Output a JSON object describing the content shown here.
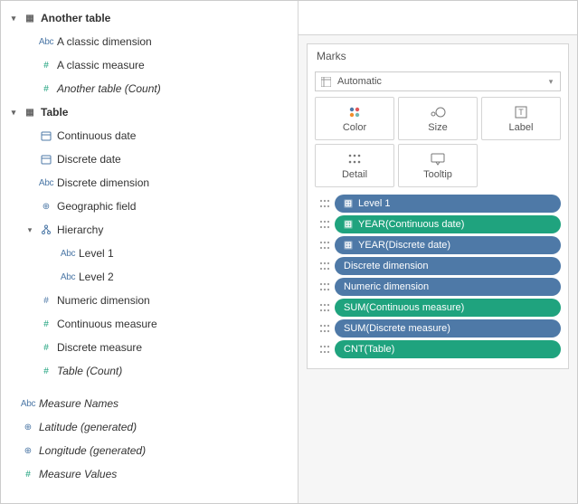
{
  "tables": [
    {
      "name": "Another table",
      "fields": [
        {
          "label": "A classic dimension",
          "icon": "abc",
          "italic": false
        },
        {
          "label": "A classic measure",
          "icon": "hash-g",
          "italic": false
        },
        {
          "label": "Another table (Count)",
          "icon": "hash-g",
          "italic": true
        }
      ]
    },
    {
      "name": "Table",
      "fields": [
        {
          "label": "Continuous date",
          "icon": "date",
          "italic": false
        },
        {
          "label": "Discrete date",
          "icon": "date",
          "italic": false
        },
        {
          "label": "Discrete dimension",
          "icon": "abc",
          "italic": false
        },
        {
          "label": "Geographic field",
          "icon": "globe",
          "italic": false
        },
        {
          "label": "Hierarchy",
          "icon": "hier",
          "italic": false,
          "expandable": true,
          "children": [
            {
              "label": "Level 1",
              "icon": "abc"
            },
            {
              "label": "Level 2",
              "icon": "abc"
            }
          ]
        },
        {
          "label": "Numeric dimension",
          "icon": "hash-b",
          "italic": false
        },
        {
          "label": "Continuous measure",
          "icon": "hash-g",
          "italic": false
        },
        {
          "label": "Discrete measure",
          "icon": "hash-g",
          "italic": false
        },
        {
          "label": "Table (Count)",
          "icon": "hash-g",
          "italic": true
        }
      ]
    }
  ],
  "generated": [
    {
      "label": "Measure Names",
      "icon": "abc"
    },
    {
      "label": "Latitude (generated)",
      "icon": "globe"
    },
    {
      "label": "Longitude (generated)",
      "icon": "globe"
    },
    {
      "label": "Measure Values",
      "icon": "hash-g"
    }
  ],
  "marks": {
    "title": "Marks",
    "type_label": "Automatic",
    "shelves": {
      "color": "Color",
      "size": "Size",
      "label": "Label",
      "detail": "Detail",
      "tooltip": "Tooltip"
    },
    "pills": [
      {
        "text": "Level 1",
        "color": "blue",
        "plus": true
      },
      {
        "text": "YEAR(Continuous date)",
        "color": "green",
        "plus": true
      },
      {
        "text": "YEAR(Discrete date)",
        "color": "blue",
        "plus": true
      },
      {
        "text": "Discrete dimension",
        "color": "blue",
        "plus": false
      },
      {
        "text": "Numeric dimension",
        "color": "blue",
        "plus": false
      },
      {
        "text": "SUM(Continuous measure)",
        "color": "green",
        "plus": false
      },
      {
        "text": "SUM(Discrete measure)",
        "color": "blue",
        "plus": false
      },
      {
        "text": "CNT(Table)",
        "color": "green",
        "plus": false
      }
    ]
  }
}
